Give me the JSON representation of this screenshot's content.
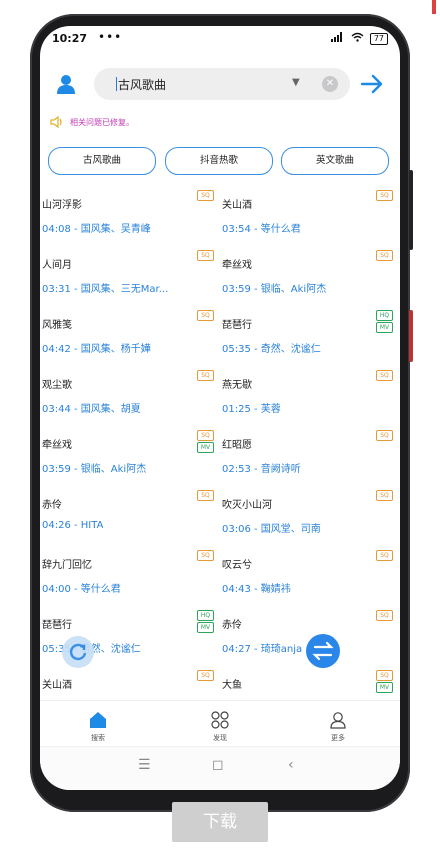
{
  "status_bar": {
    "time": "10:27",
    "more": "•••",
    "battery": "77"
  },
  "search": {
    "value": "古风歌曲"
  },
  "notice": {
    "text": "相关问题已修复。"
  },
  "chips": [
    "古风歌曲",
    "抖音热歌",
    "英文歌曲"
  ],
  "songs_left": [
    {
      "title": "山河浮影",
      "meta": "04:08 - 国风集、吴青峰",
      "badges": [
        "SQ"
      ]
    },
    {
      "title": "人间月",
      "meta": "03:31 - 国风集、三无Mar...",
      "badges": [
        "SQ"
      ]
    },
    {
      "title": "风雅笺",
      "meta": "04:42 - 国风集、杨千嬅",
      "badges": [
        "SQ"
      ]
    },
    {
      "title": "观尘歌",
      "meta": "03:44 - 国风集、胡夏",
      "badges": [
        "SQ"
      ]
    },
    {
      "title": "牵丝戏",
      "meta": "03:59 - 银临、Aki阿杰",
      "badges": [
        "SQ",
        "MV"
      ]
    },
    {
      "title": "赤伶",
      "meta": "04:26 - HITA",
      "badges": [
        "SQ"
      ]
    },
    {
      "title": "辞九门回忆",
      "meta": "04:00 - 等什么君",
      "badges": [
        "SQ"
      ]
    },
    {
      "title": "琵琶行",
      "meta": "05:35 - 奇然、沈谧仁",
      "badges": [
        "HQ",
        "MV"
      ]
    },
    {
      "title": "关山酒",
      "meta": "",
      "badges": [
        "SQ"
      ]
    }
  ],
  "songs_right": [
    {
      "title": "关山酒",
      "meta": "03:54 - 等什么君",
      "badges": [
        "SQ"
      ]
    },
    {
      "title": "牵丝戏",
      "meta": "03:59 - 银临、Aki阿杰",
      "badges": [
        "SQ"
      ]
    },
    {
      "title": "琵琶行",
      "meta": "05:35 - 奇然、沈谧仁",
      "badges": [
        "HQ",
        "MV"
      ]
    },
    {
      "title": "燕无歇",
      "meta": "01:25 - 芙蓉",
      "badges": [
        "SQ"
      ]
    },
    {
      "title": "红昭愿",
      "meta": "02:53 - 音阙诗听",
      "badges": [
        "SQ"
      ]
    },
    {
      "title": "吹灭小山河",
      "meta": "03:06 - 国风堂、司南",
      "badges": [
        "SQ"
      ]
    },
    {
      "title": "叹云兮",
      "meta": "04:43 - 鞠婧祎",
      "badges": [
        "SQ"
      ]
    },
    {
      "title": "赤伶",
      "meta": "04:27 - 琦琦anja",
      "badges": [
        "SQ"
      ]
    },
    {
      "title": "大鱼",
      "meta": "",
      "badges": [
        "SQ",
        "MV"
      ]
    }
  ],
  "tabs": [
    {
      "label": "搜索",
      "icon": "home-icon",
      "active": true
    },
    {
      "label": "发现",
      "icon": "grid-icon",
      "active": false
    },
    {
      "label": "更多",
      "icon": "user-outline-icon",
      "active": false
    }
  ],
  "navbar": {
    "menu": "☰",
    "home": "◻",
    "back": "‹"
  },
  "download_label": "下载",
  "colors": {
    "accent": "#2a86e8",
    "meta": "#2a82d8",
    "sq": "#e39a3a",
    "hq": "#2ea35a",
    "notice": "#c13bb5"
  }
}
